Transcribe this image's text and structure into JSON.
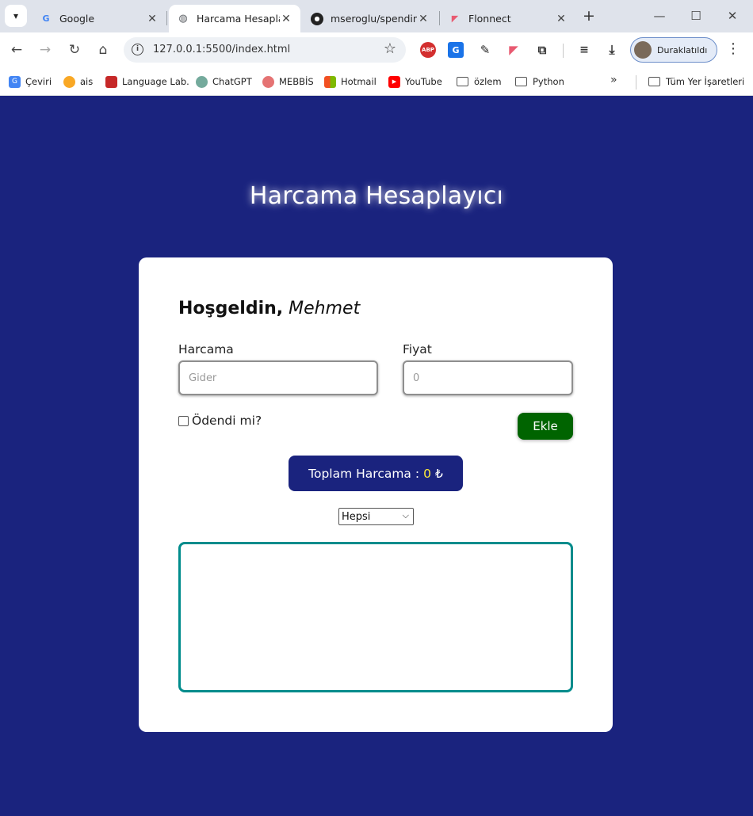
{
  "browser": {
    "tabs": [
      {
        "title": "Google",
        "icon": "google-icon"
      },
      {
        "title": "Harcama Hesaplayıcı",
        "icon": "globe-icon"
      },
      {
        "title": "mseroglu/spending-ca",
        "icon": "github-icon"
      },
      {
        "title": "Flonnect",
        "icon": "flonnect-icon"
      }
    ],
    "url": "127.0.0.1:5500/index.html",
    "profile_label": "Duraklatıldı",
    "bookmarks": [
      "Çeviri",
      "ais",
      "Language Lab.",
      "ChatGPT",
      "MEBBİS",
      "Hotmail",
      "YouTube",
      "özlem",
      "Python"
    ],
    "all_bookmarks": "Tüm Yer İşaretleri"
  },
  "page": {
    "title": "Harcama Hesaplayıcı",
    "greeting_prefix": "Hoşgeldin,",
    "greeting_name": "Mehmet",
    "expense_label": "Harcama",
    "expense_placeholder": "Gider",
    "price_label": "Fiyat",
    "price_placeholder": "0",
    "paid_label": "Ödendi mi?",
    "add_button": "Ekle",
    "total_label": "Toplam Harcama :",
    "total_value": "0",
    "currency": "₺",
    "filter_selected": "Hepsi"
  },
  "colors": {
    "page_bg": "#1a237e",
    "add_button": "#006400",
    "list_border": "#008c8c",
    "total_value": "#ffeb3b"
  }
}
